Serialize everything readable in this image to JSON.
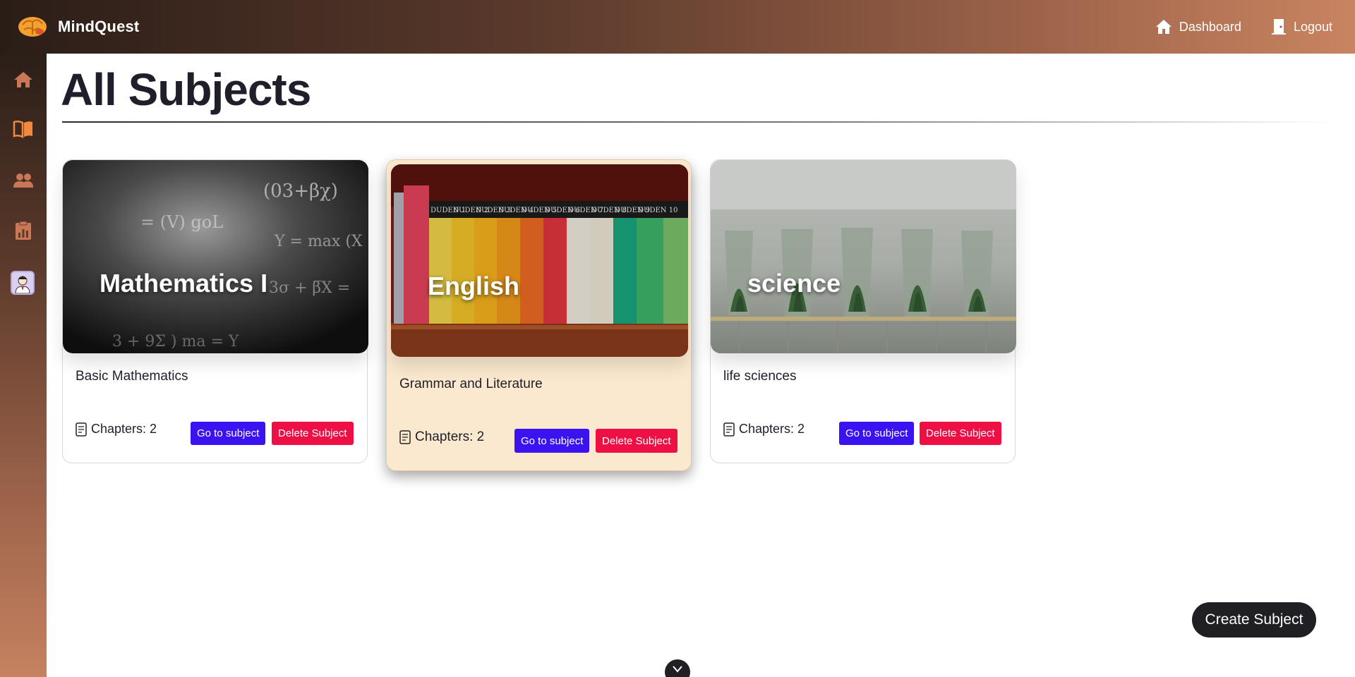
{
  "app": {
    "name": "MindQuest"
  },
  "header": {
    "dashboard_label": "Dashboard",
    "logout_label": "Logout"
  },
  "sidebar": {
    "items": [
      {
        "icon": "home-icon"
      },
      {
        "icon": "book-icon",
        "active": true
      },
      {
        "icon": "users-icon"
      },
      {
        "icon": "clipboard-chart-icon"
      },
      {
        "icon": "avatar"
      }
    ],
    "active_color": "#f08a3c"
  },
  "main": {
    "title": "All Subjects",
    "subjects": [
      {
        "name": "Mathematics I",
        "description": "Basic Mathematics",
        "chapters_label": "Chapters: 2",
        "go_label": "Go to subject",
        "delete_label": "Delete Subject"
      },
      {
        "name": "English",
        "description": "Grammar and Literature",
        "chapters_label": "Chapters: 2",
        "go_label": "Go to subject",
        "delete_label": "Delete Subject"
      },
      {
        "name": "science",
        "description": "life sciences",
        "chapters_label": "Chapters: 2",
        "go_label": "Go to subject",
        "delete_label": "Delete Subject"
      }
    ],
    "math_overlay": {
      "line1": "(03+βχ)",
      "line2": "= (V) goL",
      "line3": "Y = max (X",
      "line4": "3σ + β̅X =",
      "line5": "3 + 9Σ ) ma = Y"
    },
    "book_spines": [
      "DUDEN 1",
      "DUDEN 2",
      "DUDEN 3",
      "DUDEN 4",
      "DUDEN 5",
      "DUDEN 6",
      "DUDEN 7",
      "DUDEN 8",
      "DUDEN 9",
      "DUDEN 10"
    ],
    "create_label": "Create Subject"
  },
  "colors": {
    "go_button": "#3a13f0",
    "delete_button": "#ee0f44",
    "active_card": "#fbe9cf"
  }
}
